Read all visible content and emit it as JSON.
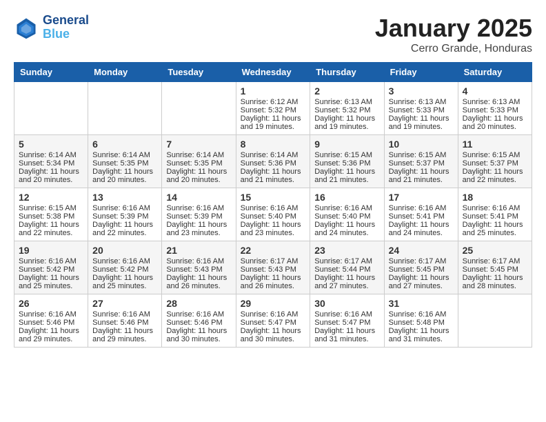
{
  "header": {
    "logo_line1": "General",
    "logo_line2": "Blue",
    "month": "January 2025",
    "location": "Cerro Grande, Honduras"
  },
  "days_of_week": [
    "Sunday",
    "Monday",
    "Tuesday",
    "Wednesday",
    "Thursday",
    "Friday",
    "Saturday"
  ],
  "weeks": [
    [
      {
        "day": "",
        "info": ""
      },
      {
        "day": "",
        "info": ""
      },
      {
        "day": "",
        "info": ""
      },
      {
        "day": "1",
        "info": "Sunrise: 6:12 AM\nSunset: 5:32 PM\nDaylight: 11 hours and 19 minutes."
      },
      {
        "day": "2",
        "info": "Sunrise: 6:13 AM\nSunset: 5:32 PM\nDaylight: 11 hours and 19 minutes."
      },
      {
        "day": "3",
        "info": "Sunrise: 6:13 AM\nSunset: 5:33 PM\nDaylight: 11 hours and 19 minutes."
      },
      {
        "day": "4",
        "info": "Sunrise: 6:13 AM\nSunset: 5:33 PM\nDaylight: 11 hours and 20 minutes."
      }
    ],
    [
      {
        "day": "5",
        "info": "Sunrise: 6:14 AM\nSunset: 5:34 PM\nDaylight: 11 hours and 20 minutes."
      },
      {
        "day": "6",
        "info": "Sunrise: 6:14 AM\nSunset: 5:35 PM\nDaylight: 11 hours and 20 minutes."
      },
      {
        "day": "7",
        "info": "Sunrise: 6:14 AM\nSunset: 5:35 PM\nDaylight: 11 hours and 20 minutes."
      },
      {
        "day": "8",
        "info": "Sunrise: 6:14 AM\nSunset: 5:36 PM\nDaylight: 11 hours and 21 minutes."
      },
      {
        "day": "9",
        "info": "Sunrise: 6:15 AM\nSunset: 5:36 PM\nDaylight: 11 hours and 21 minutes."
      },
      {
        "day": "10",
        "info": "Sunrise: 6:15 AM\nSunset: 5:37 PM\nDaylight: 11 hours and 21 minutes."
      },
      {
        "day": "11",
        "info": "Sunrise: 6:15 AM\nSunset: 5:37 PM\nDaylight: 11 hours and 22 minutes."
      }
    ],
    [
      {
        "day": "12",
        "info": "Sunrise: 6:15 AM\nSunset: 5:38 PM\nDaylight: 11 hours and 22 minutes."
      },
      {
        "day": "13",
        "info": "Sunrise: 6:16 AM\nSunset: 5:39 PM\nDaylight: 11 hours and 22 minutes."
      },
      {
        "day": "14",
        "info": "Sunrise: 6:16 AM\nSunset: 5:39 PM\nDaylight: 11 hours and 23 minutes."
      },
      {
        "day": "15",
        "info": "Sunrise: 6:16 AM\nSunset: 5:40 PM\nDaylight: 11 hours and 23 minutes."
      },
      {
        "day": "16",
        "info": "Sunrise: 6:16 AM\nSunset: 5:40 PM\nDaylight: 11 hours and 24 minutes."
      },
      {
        "day": "17",
        "info": "Sunrise: 6:16 AM\nSunset: 5:41 PM\nDaylight: 11 hours and 24 minutes."
      },
      {
        "day": "18",
        "info": "Sunrise: 6:16 AM\nSunset: 5:41 PM\nDaylight: 11 hours and 25 minutes."
      }
    ],
    [
      {
        "day": "19",
        "info": "Sunrise: 6:16 AM\nSunset: 5:42 PM\nDaylight: 11 hours and 25 minutes."
      },
      {
        "day": "20",
        "info": "Sunrise: 6:16 AM\nSunset: 5:42 PM\nDaylight: 11 hours and 25 minutes."
      },
      {
        "day": "21",
        "info": "Sunrise: 6:16 AM\nSunset: 5:43 PM\nDaylight: 11 hours and 26 minutes."
      },
      {
        "day": "22",
        "info": "Sunrise: 6:17 AM\nSunset: 5:43 PM\nDaylight: 11 hours and 26 minutes."
      },
      {
        "day": "23",
        "info": "Sunrise: 6:17 AM\nSunset: 5:44 PM\nDaylight: 11 hours and 27 minutes."
      },
      {
        "day": "24",
        "info": "Sunrise: 6:17 AM\nSunset: 5:45 PM\nDaylight: 11 hours and 27 minutes."
      },
      {
        "day": "25",
        "info": "Sunrise: 6:17 AM\nSunset: 5:45 PM\nDaylight: 11 hours and 28 minutes."
      }
    ],
    [
      {
        "day": "26",
        "info": "Sunrise: 6:16 AM\nSunset: 5:46 PM\nDaylight: 11 hours and 29 minutes."
      },
      {
        "day": "27",
        "info": "Sunrise: 6:16 AM\nSunset: 5:46 PM\nDaylight: 11 hours and 29 minutes."
      },
      {
        "day": "28",
        "info": "Sunrise: 6:16 AM\nSunset: 5:46 PM\nDaylight: 11 hours and 30 minutes."
      },
      {
        "day": "29",
        "info": "Sunrise: 6:16 AM\nSunset: 5:47 PM\nDaylight: 11 hours and 30 minutes."
      },
      {
        "day": "30",
        "info": "Sunrise: 6:16 AM\nSunset: 5:47 PM\nDaylight: 11 hours and 31 minutes."
      },
      {
        "day": "31",
        "info": "Sunrise: 6:16 AM\nSunset: 5:48 PM\nDaylight: 11 hours and 31 minutes."
      },
      {
        "day": "",
        "info": ""
      }
    ]
  ]
}
